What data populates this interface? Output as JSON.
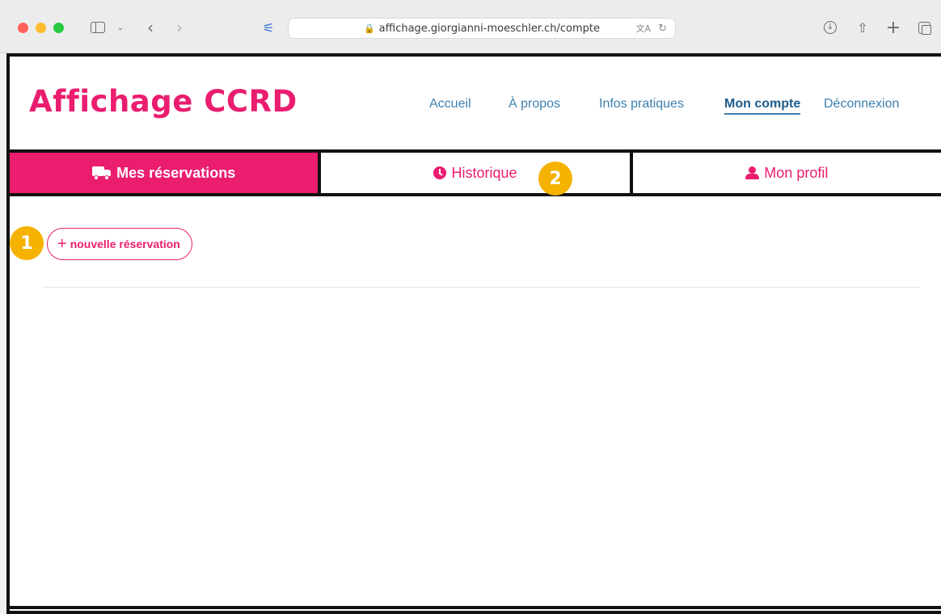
{
  "browser": {
    "url": "affichage.giorgianni-moeschler.ch/compte",
    "icons": {
      "lock": "lock-icon",
      "translate": "translate-icon",
      "reload": "reload-icon"
    }
  },
  "site": {
    "logo": "Affichage CCRD",
    "brand_color": "#ea1d6f"
  },
  "nav": {
    "items": [
      {
        "label": "Accueil",
        "active": false
      },
      {
        "label": "À propos",
        "active": false
      },
      {
        "label": "Infos pratiques",
        "active": false
      },
      {
        "label": "Mon compte",
        "active": true
      },
      {
        "label": "Déconnexion",
        "active": false
      }
    ]
  },
  "tabs": [
    {
      "label": "Mes réservations",
      "icon": "truck-icon",
      "active": true
    },
    {
      "label": "Historique",
      "icon": "clock-icon",
      "active": false
    },
    {
      "label": "Mon profil",
      "icon": "user-icon",
      "active": false
    }
  ],
  "main": {
    "new_reservation_label": "nouvelle réservation",
    "plus_glyph": "+"
  },
  "annotations": {
    "badge_1": "1",
    "badge_2": "2",
    "color": "#f5b200"
  }
}
